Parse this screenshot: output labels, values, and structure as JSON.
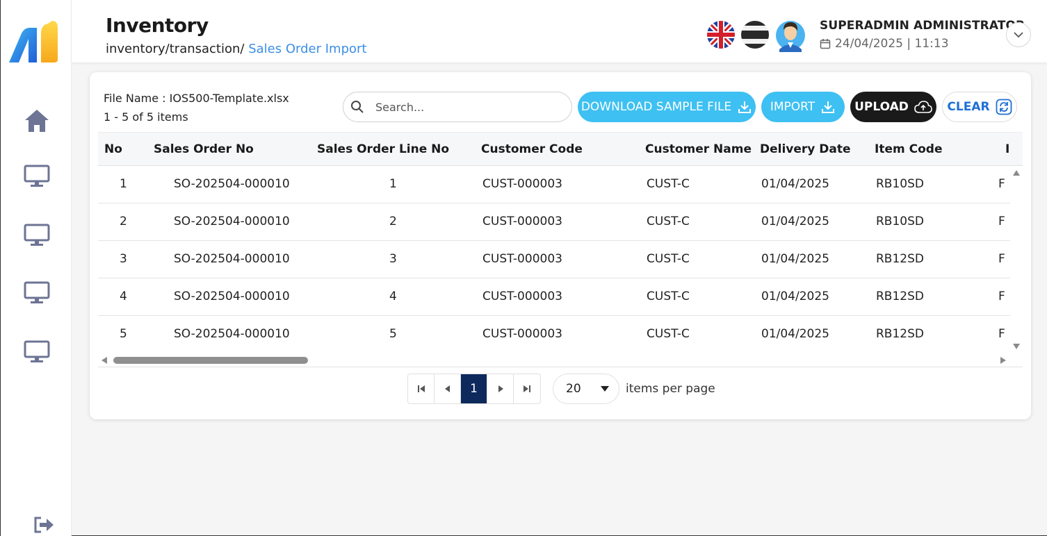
{
  "header": {
    "title": "Inventory",
    "breadcrumb_prefix": "inventory/transaction/",
    "breadcrumb_current": "Sales Order Import",
    "user_name": "SUPERADMIN ADMINISTRATOR",
    "user_datetime": "24/04/2025 | 11:13"
  },
  "sidebar": {
    "items": [
      {
        "icon": "home-icon"
      },
      {
        "icon": "monitor-icon"
      },
      {
        "icon": "monitor-icon"
      },
      {
        "icon": "monitor-icon"
      },
      {
        "icon": "monitor-icon"
      }
    ],
    "logout_icon": "logout-icon"
  },
  "toolbar": {
    "file_name": "File Name : IOS500-Template.xlsx",
    "item_count": "1 - 5 of 5 items",
    "search_placeholder": "Search...",
    "download_label": "DOWNLOAD SAMPLE FILE",
    "import_label": "IMPORT",
    "upload_label": "UPLOAD",
    "clear_label": "CLEAR"
  },
  "table": {
    "columns": [
      "No",
      "Sales Order No",
      "Sales Order Line No",
      "Customer Code",
      "Customer Name",
      "Delivery Date",
      "Item Code",
      "I"
    ],
    "rows": [
      [
        "1",
        "SO-202504-000010",
        "1",
        "CUST-000003",
        "CUST-C",
        "01/04/2025",
        "RB10SD",
        "F"
      ],
      [
        "2",
        "SO-202504-000010",
        "2",
        "CUST-000003",
        "CUST-C",
        "01/04/2025",
        "RB10SD",
        "F"
      ],
      [
        "3",
        "SO-202504-000010",
        "3",
        "CUST-000003",
        "CUST-C",
        "01/04/2025",
        "RB12SD",
        "F"
      ],
      [
        "4",
        "SO-202504-000010",
        "4",
        "CUST-000003",
        "CUST-C",
        "01/04/2025",
        "RB12SD",
        "F"
      ],
      [
        "5",
        "SO-202504-000010",
        "5",
        "CUST-000003",
        "CUST-C",
        "01/04/2025",
        "RB12SD",
        "F"
      ]
    ]
  },
  "pagination": {
    "current_page": "1",
    "page_size": "20",
    "per_page_label": "items per page"
  },
  "colors": {
    "accent_blue": "#3ec0f2",
    "link_blue": "#3b8fe6",
    "active_page": "#0e2a5c",
    "upload_dark": "#1a1a1a"
  }
}
